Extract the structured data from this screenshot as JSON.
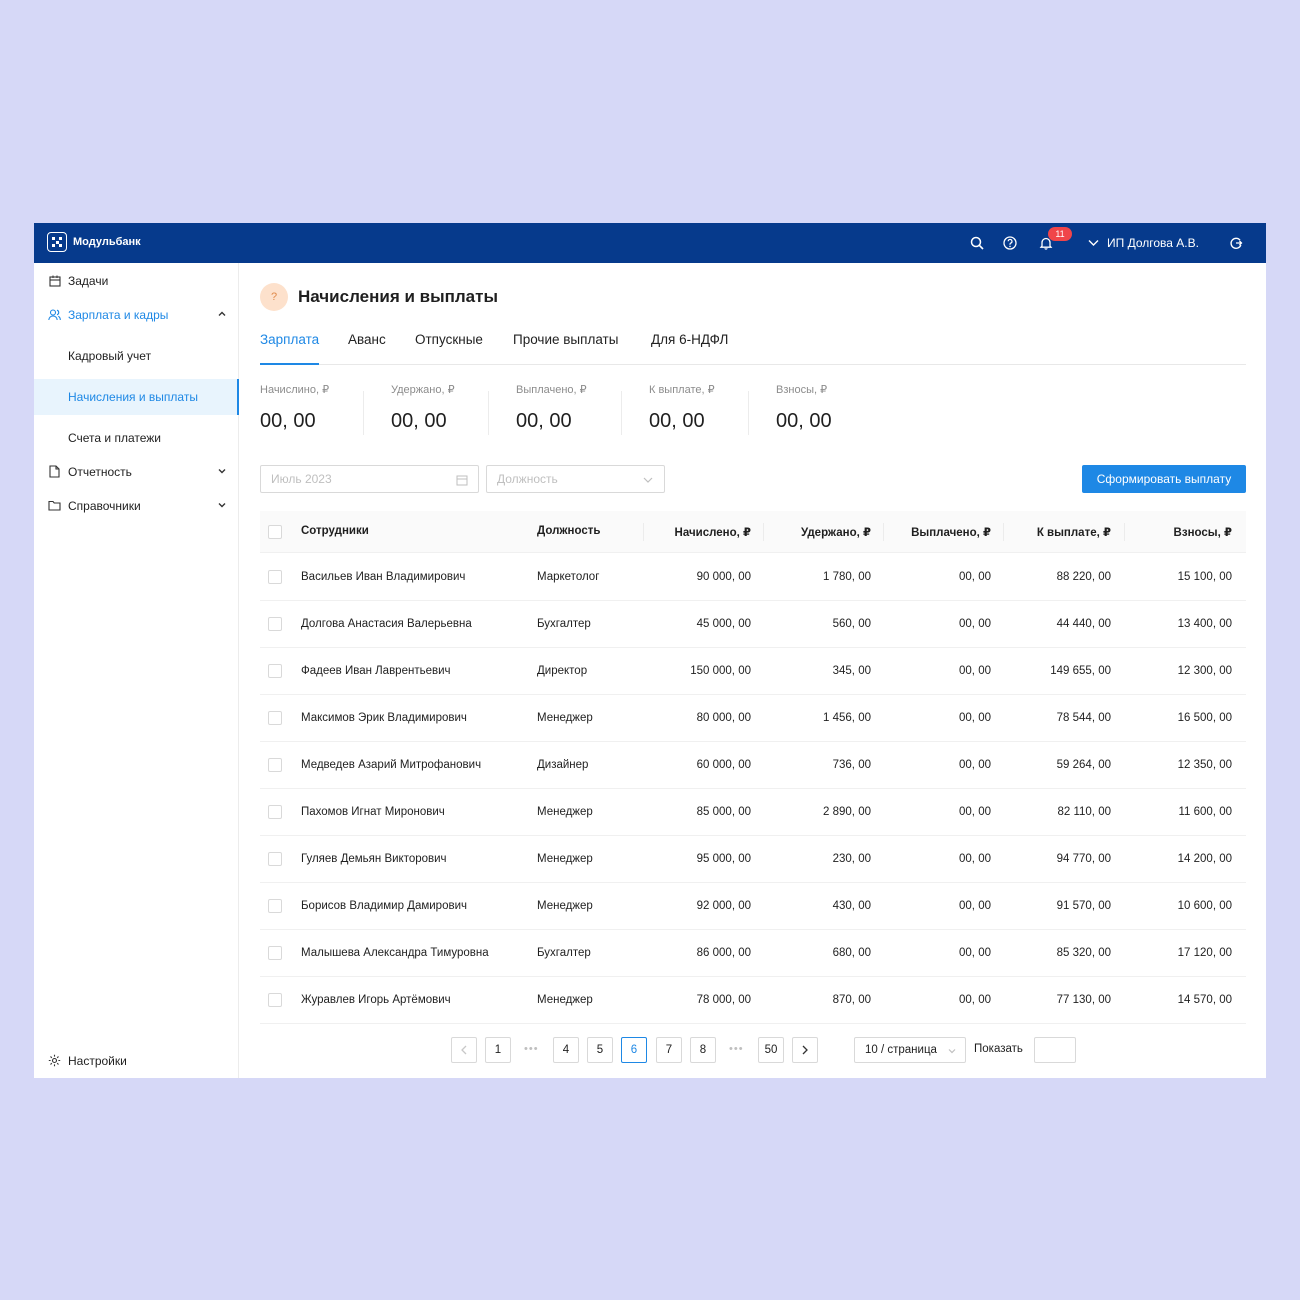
{
  "app": {
    "brand": "Модульбанк",
    "notifications_count": "11",
    "user_name": "ИП Долгова А.В."
  },
  "sidebar": {
    "items": [
      {
        "label": "Задачи"
      },
      {
        "label": "Зарплата и кадры"
      },
      {
        "label": "Кадровый учет"
      },
      {
        "label": "Начисления и выплаты"
      },
      {
        "label": "Счета и платежи"
      },
      {
        "label": "Отчетность"
      },
      {
        "label": "Справочники"
      }
    ],
    "settings": "Настройки"
  },
  "page": {
    "help_mark": "?",
    "title": "Начисления и выплаты"
  },
  "tabs": [
    "Зарплата",
    "Аванс",
    "Отпускные",
    "Прочие выплаты",
    "Для 6-НДФЛ"
  ],
  "stats": [
    {
      "label": "Начислино, ₽",
      "value": "00, 00"
    },
    {
      "label": "Удержано, ₽",
      "value": "00, 00"
    },
    {
      "label": "Выплачено, ₽",
      "value": "00, 00"
    },
    {
      "label": "К выплате, ₽",
      "value": "00, 00"
    },
    {
      "label": "Взносы, ₽",
      "value": "00, 00"
    }
  ],
  "filters": {
    "period_placeholder": "Июль 2023",
    "position_placeholder": "Должность",
    "submit": "Сформировать выплату"
  },
  "table": {
    "columns": [
      "Сотрудники",
      "Должность",
      "Начислено, ₽",
      "Удержано, ₽",
      "Выплачено, ₽",
      "К выплате, ₽",
      "Взносы, ₽"
    ],
    "rows": [
      [
        "Васильев Иван Владимирович",
        "Маркетолог",
        "90 000, 00",
        "1 780, 00",
        "00, 00",
        "88 220, 00",
        "15 100, 00"
      ],
      [
        "Долгова Анастасия Валерьевна",
        "Бухгалтер",
        "45 000, 00",
        "560, 00",
        "00, 00",
        "44 440, 00",
        "13 400, 00"
      ],
      [
        "Фадеев Иван Лаврентьевич",
        "Директор",
        "150 000, 00",
        "345, 00",
        "00, 00",
        "149 655, 00",
        "12 300, 00"
      ],
      [
        "Максимов Эрик Владимирович",
        "Менеджер",
        "80 000, 00",
        "1 456, 00",
        "00, 00",
        "78 544, 00",
        "16 500, 00"
      ],
      [
        "Медведев Азарий Митрофанович",
        "Дизайнер",
        "60 000, 00",
        "736, 00",
        "00, 00",
        "59 264, 00",
        "12 350, 00"
      ],
      [
        "Пахомов Игнат Миронович",
        "Менеджер",
        "85 000, 00",
        "2 890, 00",
        "00, 00",
        "82 110, 00",
        "11 600, 00"
      ],
      [
        "Гуляев Демьян Викторович",
        "Менеджер",
        "95 000, 00",
        "230, 00",
        "00, 00",
        "94 770, 00",
        "14 200, 00"
      ],
      [
        "Борисов Владимир Дамирович",
        "Менеджер",
        "92 000, 00",
        "430, 00",
        "00, 00",
        "91 570, 00",
        "10 600, 00"
      ],
      [
        "Малышева Александра Тимуровна",
        "Бухгалтер",
        "86 000, 00",
        "680, 00",
        "00, 00",
        "85 320, 00",
        "17 120, 00"
      ],
      [
        "Журавлев Игорь Артёмович",
        "Менеджер",
        "78 000, 00",
        "870, 00",
        "00, 00",
        "77 130, 00",
        "14 570, 00"
      ]
    ]
  },
  "pagination": {
    "pages": [
      "1",
      "4",
      "5",
      "6",
      "7",
      "8",
      "50"
    ],
    "current": "6",
    "ellipsis": "•••",
    "page_size": "10 / страница",
    "show_label": "Показать"
  },
  "colors": {
    "topbar": "#063a8c",
    "accent": "#1e88e5",
    "badge": "#f0454a",
    "background": "#d6d8f7"
  }
}
